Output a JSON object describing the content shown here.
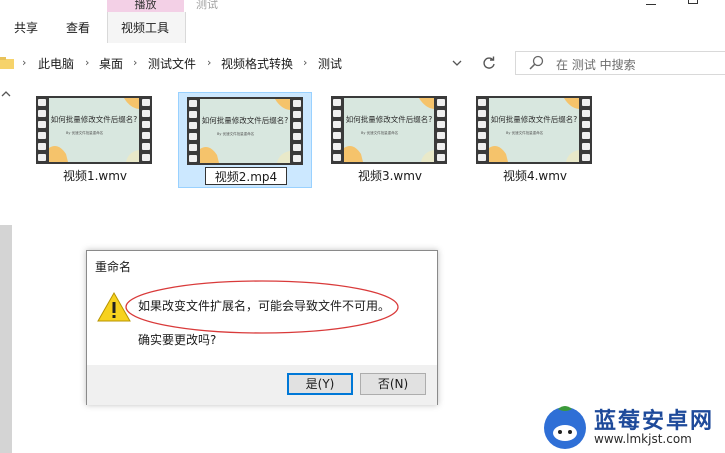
{
  "ribbon": {
    "tabs": [
      "共享",
      "查看"
    ],
    "context_group_label": "播放",
    "context_tab": "视频工具",
    "window_title": "测试"
  },
  "address": {
    "breadcrumbs": [
      "此电脑",
      "桌面",
      "测试文件",
      "视频格式转换",
      "测试"
    ]
  },
  "search": {
    "placeholder": "在 测试 中搜索"
  },
  "thumbnail": {
    "title": "如何批量修改文件后缀名?",
    "subtitle": "By 优速文件批量重命名"
  },
  "files": [
    {
      "name": "视频1.wmv",
      "selected": false,
      "editing": false
    },
    {
      "name": "视频2.mp4",
      "selected": true,
      "editing": true
    },
    {
      "name": "视频3.wmv",
      "selected": false,
      "editing": false
    },
    {
      "name": "视频4.wmv",
      "selected": false,
      "editing": false
    }
  ],
  "dialog": {
    "title": "重命名",
    "message": "如果改变文件扩展名，可能会导致文件不可用。",
    "question": "确实要更改吗?",
    "yes_label": "是(Y)",
    "no_label": "否(N)",
    "warning_icon": "warning-icon",
    "highlight_color": "#d93a3a"
  },
  "watermark": {
    "title": "蓝莓安卓网",
    "url": "www.lmkjst.com"
  },
  "colors": {
    "selection_bg": "#cce8ff",
    "context_tab": "#f3d0e6",
    "accent": "#0078d7"
  }
}
